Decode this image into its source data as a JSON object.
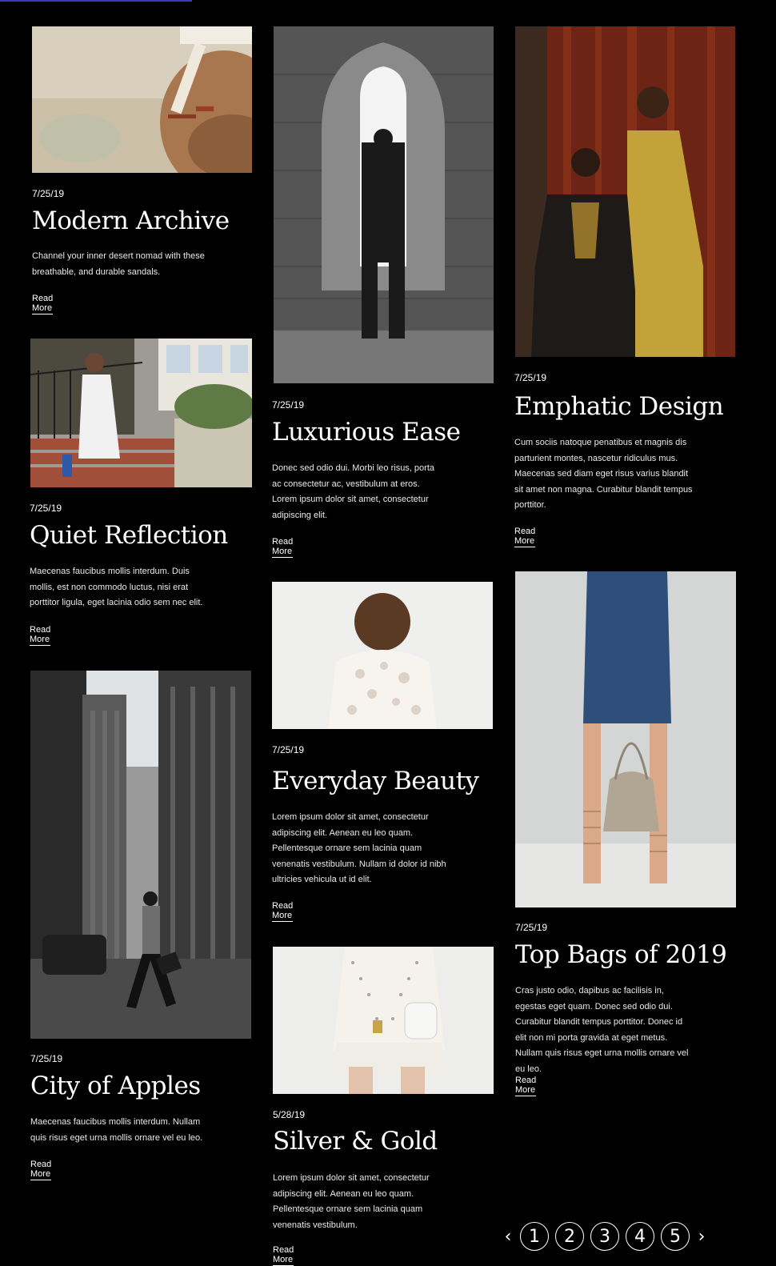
{
  "posts": [
    {
      "date": "7/25/19",
      "title": "Modern Archive",
      "excerpt": "Channel your inner desert nomad with these breathable, and durable sandals.",
      "more": "Read More"
    },
    {
      "date": "7/25/19",
      "title": "Luxurious Ease",
      "excerpt": "Donec sed odio dui. Morbi leo risus, porta ac consectetur ac, vestibulum at eros. Lorem ipsum dolor sit amet, consectetur adipiscing elit.",
      "more": "Read More"
    },
    {
      "date": "7/25/19",
      "title": "Emphatic Design",
      "excerpt": "Cum sociis natoque penatibus et magnis dis parturient montes, nascetur ridiculus mus. Maecenas sed diam eget risus varius blandit sit amet non magna. Curabitur blandit tempus porttitor.",
      "more": "Read More"
    },
    {
      "date": "7/25/19",
      "title": "Quiet Reflection",
      "excerpt": "Maecenas faucibus mollis interdum. Duis mollis, est non commodo luctus, nisi erat porttitor ligula, eget lacinia odio sem nec elit.",
      "more": "Read More"
    },
    {
      "date": "7/25/19",
      "title": "Everyday Beauty",
      "excerpt": "Lorem ipsum dolor sit amet, consectetur adipiscing elit. Aenean eu leo quam. Pellentesque ornare sem lacinia quam venenatis vestibulum. Nullam id dolor id nibh ultricies vehicula ut id elit.",
      "more": "Read More"
    },
    {
      "date": "7/25/19",
      "title": "Top Bags of 2019",
      "excerpt": "Cras justo odio, dapibus ac facilisis in, egestas eget quam. Donec sed odio dui. Curabitur blandit tempus porttitor. Donec id elit non mi porta gravida at eget metus. Nullam quis risus eget urna mollis ornare vel eu leo.",
      "more": "Read More"
    },
    {
      "date": "7/25/19",
      "title": "City of Apples",
      "excerpt": "Maecenas faucibus mollis interdum. Nullam quis risus eget urna mollis ornare vel eu leo.",
      "more": "Read More"
    },
    {
      "date": "5/28/19",
      "title": "Silver & Gold",
      "excerpt": "Lorem ipsum dolor sit amet, consectetur adipiscing elit. Aenean eu leo quam. Pellentesque ornare sem lacinia quam venenatis vestibulum.",
      "more": "Read More"
    }
  ],
  "pagination": {
    "prev": "‹",
    "pages": [
      "1",
      "2",
      "3",
      "4",
      "5"
    ],
    "next": "›"
  },
  "colors": {
    "background": "#000000",
    "text": "#ffffff",
    "accent_bar": "#3b3ab8"
  }
}
